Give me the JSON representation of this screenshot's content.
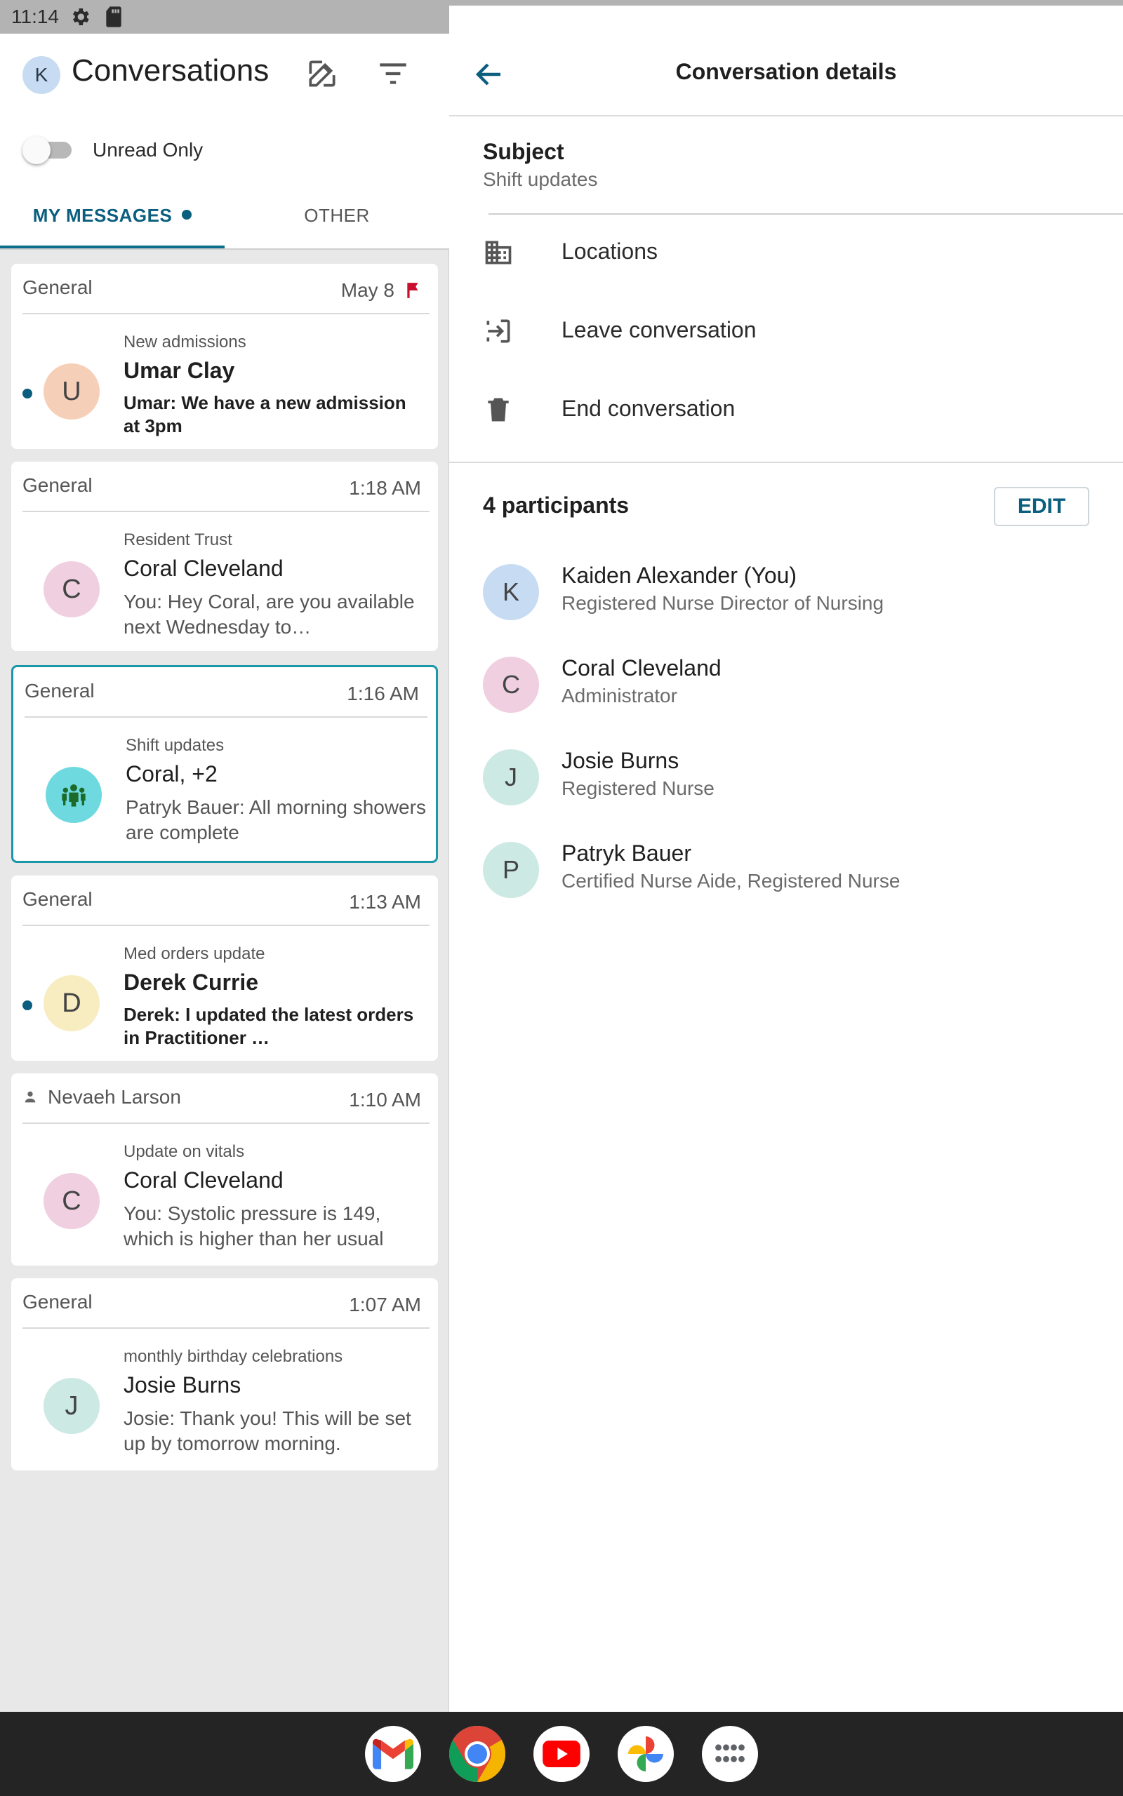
{
  "status_bar": {
    "time": "11:14"
  },
  "left": {
    "avatar_initial": "K",
    "title": "Conversations",
    "toggle_label": "Unread Only",
    "tabs": {
      "my_messages": "MY MESSAGES",
      "other": "OTHER"
    },
    "conversations": [
      {
        "category": "General",
        "time": "May 8",
        "flagged": true,
        "unread": true,
        "avatar": "U",
        "avatar_color": "#f6cfb9",
        "subject": "New admissions",
        "name": "Umar Clay",
        "preview": "Umar: We have a new admission at 3pm"
      },
      {
        "category": "General",
        "time": "1:18 AM",
        "flagged": false,
        "unread": false,
        "avatar": "C",
        "avatar_color": "#efcfe0",
        "subject": "Resident Trust",
        "name": "Coral Cleveland",
        "preview": "You: Hey Coral, are you available next Wednesday to…"
      },
      {
        "category": "General",
        "time": "1:16 AM",
        "flagged": false,
        "unread": false,
        "selected": true,
        "avatar": "group-icon",
        "avatar_color": "#6fd9e0",
        "subject": "Shift updates",
        "name": "Coral, +2",
        "preview": "Patryk Bauer: All morning showers are complete"
      },
      {
        "category": "General",
        "time": "1:13 AM",
        "flagged": false,
        "unread": true,
        "avatar": "D",
        "avatar_color": "#f8ecc1",
        "subject": "Med orders update",
        "name": "Derek Currie",
        "preview": "Derek: I updated the latest orders in Practitioner …"
      },
      {
        "category": "Nevaeh Larson",
        "time": "1:10 AM",
        "flagged": false,
        "unread": false,
        "avatar": "C",
        "avatar_color": "#efcfe0",
        "subject": "Update on vitals",
        "name": "Coral Cleveland",
        "preview": "You: Systolic pressure is 149, which is higher than her usual"
      },
      {
        "category": "General",
        "time": "1:07 AM",
        "flagged": false,
        "unread": false,
        "avatar": "J",
        "avatar_color": "#cce9e4",
        "subject": "monthly birthday celebrations",
        "name": "Josie Burns",
        "preview": "Josie: Thank you! This will be set up by tomorrow morning."
      }
    ]
  },
  "right": {
    "title": "Conversation details",
    "subject_label": "Subject",
    "subject_value": "Shift updates",
    "actions": [
      {
        "icon": "building-icon",
        "label": "Locations"
      },
      {
        "icon": "leave-icon",
        "label": "Leave conversation"
      },
      {
        "icon": "trash-icon",
        "label": "End conversation"
      }
    ],
    "participants_count": "4 participants",
    "edit_label": "EDIT",
    "participants": [
      {
        "avatar": "K",
        "avatar_color": "#c7dcf2",
        "name": "Kaiden Alexander (You)",
        "role": "Registered Nurse Director of Nursing"
      },
      {
        "avatar": "C",
        "avatar_color": "#efcfe0",
        "name": "Coral Cleveland",
        "role": "Administrator"
      },
      {
        "avatar": "J",
        "avatar_color": "#cce9e4",
        "name": "Josie Burns",
        "role": "Registered Nurse"
      },
      {
        "avatar": "P",
        "avatar_color": "#cce9e4",
        "name": "Patryk Bauer",
        "role": "Certified Nurse Aide, Registered Nurse"
      }
    ]
  },
  "dock": {
    "apps": [
      "gmail-icon",
      "chrome-icon",
      "youtube-icon",
      "photos-icon",
      "app-drawer-icon"
    ]
  },
  "colors": {
    "accent": "#0b5e7e",
    "selected_border": "#1a97a8",
    "flag": "#c8102e"
  }
}
